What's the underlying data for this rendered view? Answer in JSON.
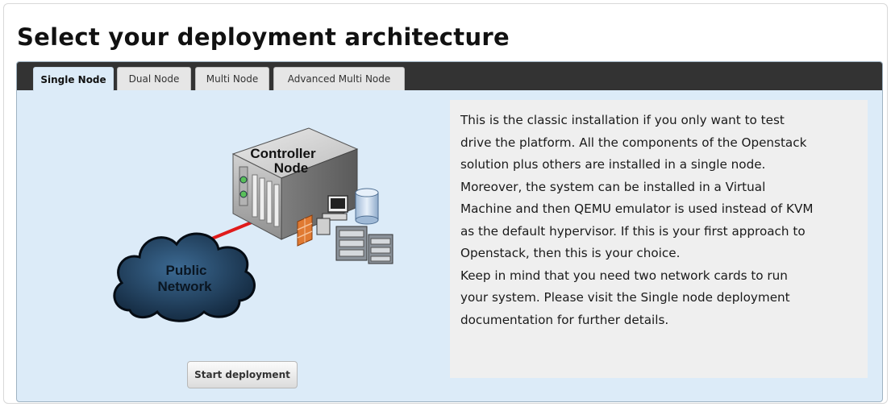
{
  "page": {
    "title": "Select your deployment architecture"
  },
  "tabs": [
    {
      "label": "Single Node",
      "active": true
    },
    {
      "label": "Dual Node",
      "active": false
    },
    {
      "label": "Multi Node",
      "active": false
    },
    {
      "label": "Advanced Multi Node",
      "active": false
    }
  ],
  "diagram": {
    "controller_label_line1": "Controller",
    "controller_label_line2": "Node",
    "network_label_line1": "Public",
    "network_label_line2": "Network"
  },
  "description": {
    "lines": [
      "This is the classic installation if you only want to test",
      "drive the platform. All the components of the Openstack",
      "solution plus others are installed in a single node.",
      "Moreover, the system can be installed in a Virtual",
      "Machine and then QEMU emulator is used instead of KVM",
      "as the default hypervisor. If this is your first approach to",
      "Openstack, then this is your choice.",
      "Keep in mind that you need two network cards to run",
      "your system. Please visit the Single node deployment",
      "documentation for further details."
    ]
  },
  "actions": {
    "start_label": "Start deployment"
  },
  "colors": {
    "panel_background": "#dcebf8",
    "tab_bar": "#333333",
    "description_background": "#efefef",
    "network_link": "#e01b1b",
    "cloud": "#1b3550"
  }
}
